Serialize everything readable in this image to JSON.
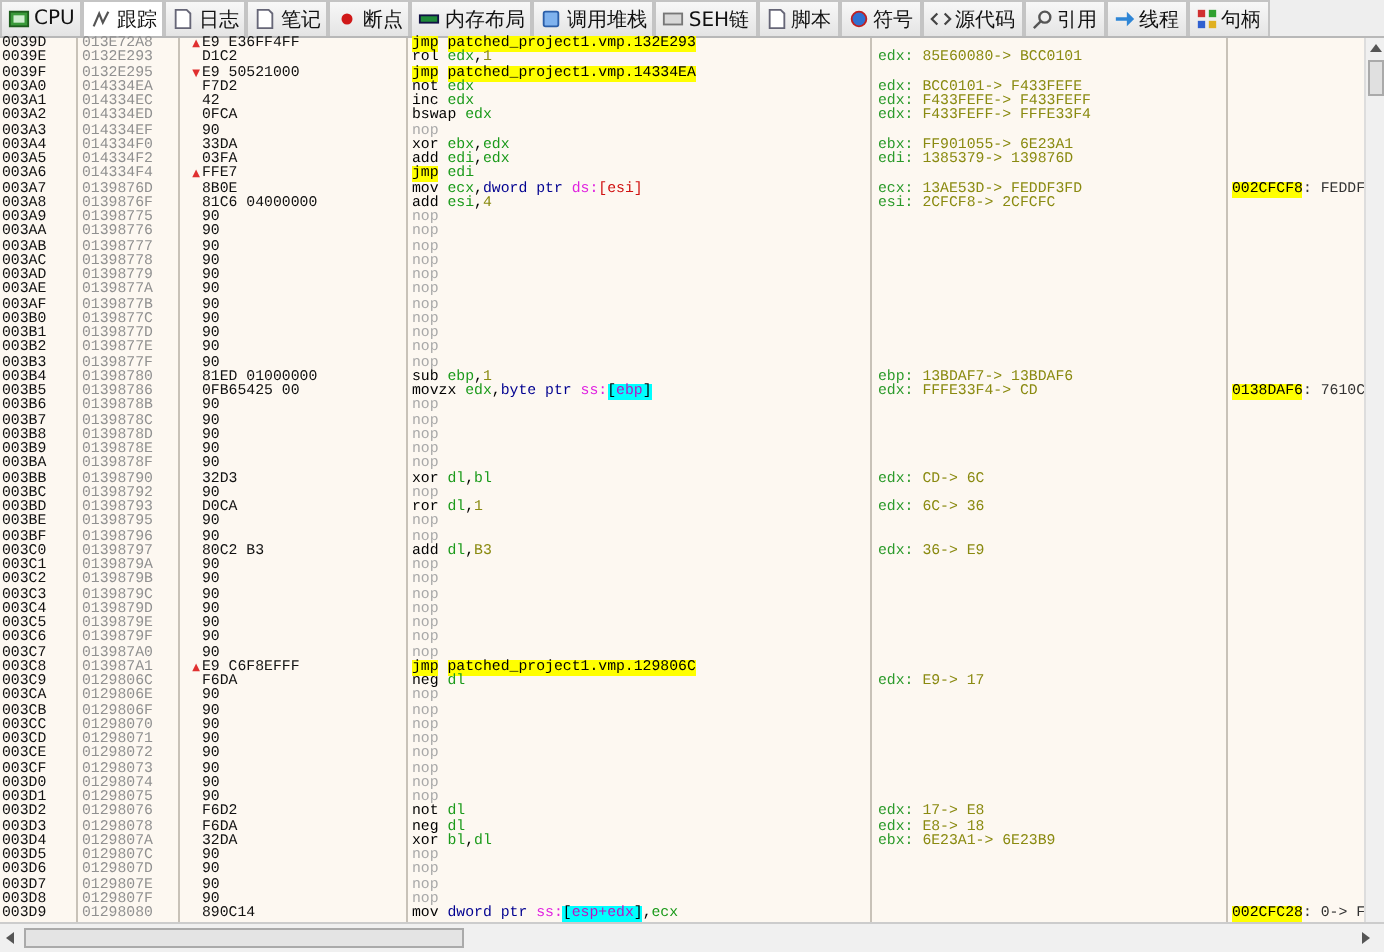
{
  "tabs": [
    {
      "label": "CPU",
      "selected": false
    },
    {
      "label": "跟踪",
      "selected": true
    },
    {
      "label": "日志",
      "selected": false
    },
    {
      "label": "笔记",
      "selected": false
    },
    {
      "label": "断点",
      "selected": false
    },
    {
      "label": "内存布局",
      "selected": false
    },
    {
      "label": "调用堆栈",
      "selected": false
    },
    {
      "label": "SEH链",
      "selected": false
    },
    {
      "label": "脚本",
      "selected": false
    },
    {
      "label": "符号",
      "selected": false
    },
    {
      "label": "源代码",
      "selected": false
    },
    {
      "label": "引用",
      "selected": false
    },
    {
      "label": "线程",
      "selected": false
    },
    {
      "label": "句柄",
      "selected": false
    }
  ],
  "trace": {
    "rows": [
      {
        "index": "0039D",
        "address": "013E72A8",
        "jump_arrow": "▲",
        "bytes": "E9 E36FF4FF",
        "instruction": [
          {
            "kind": "jmp",
            "text": "jmp"
          },
          {
            "kind": "target",
            "text": "patched_project1.vmp.132E293"
          }
        ]
      },
      {
        "index": "0039E",
        "address": "0132E293",
        "bytes": "D1C2",
        "instruction": [
          {
            "kind": "op",
            "text": "rol"
          },
          {
            "kind": "reg",
            "text": "edx"
          },
          {
            "kind": "punct",
            "text": ","
          },
          {
            "kind": "imm",
            "text": "1"
          }
        ],
        "comment": {
          "reg": "edx:",
          "change": "85E60080-> BCC0101"
        }
      },
      {
        "index": "0039F",
        "address": "0132E295",
        "jump_arrow": "▼",
        "bytes": "E9 50521000",
        "instruction": [
          {
            "kind": "jmp",
            "text": "jmp"
          },
          {
            "kind": "target",
            "text": "patched_project1.vmp.14334EA"
          }
        ]
      },
      {
        "index": "003A0",
        "address": "014334EA",
        "bytes": "F7D2",
        "instruction": [
          {
            "kind": "op",
            "text": "not"
          },
          {
            "kind": "reg",
            "text": "edx"
          }
        ],
        "comment": {
          "reg": "edx:",
          "change": "BCC0101-> F433FEFE"
        }
      },
      {
        "index": "003A1",
        "address": "014334EC",
        "bytes": "42",
        "instruction": [
          {
            "kind": "op",
            "text": "inc"
          },
          {
            "kind": "reg",
            "text": "edx"
          }
        ],
        "comment": {
          "reg": "edx:",
          "change": "F433FEFE-> F433FEFF"
        }
      },
      {
        "index": "003A2",
        "address": "014334ED",
        "bytes": "0FCA",
        "instruction": [
          {
            "kind": "op",
            "text": "bswap"
          },
          {
            "kind": "reg",
            "text": "edx"
          }
        ],
        "comment": {
          "reg": "edx:",
          "change": "F433FEFF-> FFFE33F4"
        }
      },
      {
        "index": "003A3",
        "address": "014334EF",
        "bytes": "90",
        "instruction": [
          {
            "kind": "nop",
            "text": "nop"
          }
        ]
      },
      {
        "index": "003A4",
        "address": "014334F0",
        "bytes": "33DA",
        "instruction": [
          {
            "kind": "op",
            "text": "xor"
          },
          {
            "kind": "reg",
            "text": "ebx"
          },
          {
            "kind": "punct",
            "text": ","
          },
          {
            "kind": "reg",
            "text": "edx"
          }
        ],
        "comment": {
          "reg": "ebx:",
          "change": "FF901055-> 6E23A1"
        }
      },
      {
        "index": "003A5",
        "address": "014334F2",
        "bytes": "03FA",
        "instruction": [
          {
            "kind": "op",
            "text": "add"
          },
          {
            "kind": "reg",
            "text": "edi"
          },
          {
            "kind": "punct",
            "text": ","
          },
          {
            "kind": "reg",
            "text": "edx"
          }
        ],
        "comment": {
          "reg": "edi:",
          "change": "1385379-> 139876D"
        }
      },
      {
        "index": "003A6",
        "address": "014334F4",
        "jump_arrow": "▲",
        "bytes": "FFE7",
        "instruction": [
          {
            "kind": "jmp",
            "text": "jmp"
          },
          {
            "kind": "reg",
            "text": "edi"
          }
        ]
      },
      {
        "index": "003A7",
        "address": "0139876D",
        "bytes": "8B0E",
        "instruction": [
          {
            "kind": "op",
            "text": "mov"
          },
          {
            "kind": "reg",
            "text": "ecx"
          },
          {
            "kind": "punct",
            "text": ","
          },
          {
            "kind": "size",
            "text": "dword ptr"
          },
          {
            "kind": "seg",
            "text": "ds:"
          },
          {
            "kind": "memplain",
            "text": "[esi]"
          }
        ],
        "comment": {
          "reg": "ecx:",
          "change": "13AE53D-> FEDDF3FD"
        },
        "memory": {
          "address": "002CFCF8",
          "value": ": FEDDF"
        }
      },
      {
        "index": "003A8",
        "address": "0139876F",
        "bytes": "81C6 04000000",
        "instruction": [
          {
            "kind": "op",
            "text": "add"
          },
          {
            "kind": "reg",
            "text": "esi"
          },
          {
            "kind": "punct",
            "text": ","
          },
          {
            "kind": "imm",
            "text": "4"
          }
        ],
        "comment": {
          "reg": "esi:",
          "change": "2CFCF8-> 2CFCFC"
        }
      },
      {
        "index": "003A9",
        "address": "01398775",
        "bytes": "90",
        "instruction": [
          {
            "kind": "nop",
            "text": "nop"
          }
        ]
      },
      {
        "index": "003AA",
        "address": "01398776",
        "bytes": "90",
        "instruction": [
          {
            "kind": "nop",
            "text": "nop"
          }
        ]
      },
      {
        "index": "003AB",
        "address": "01398777",
        "bytes": "90",
        "instruction": [
          {
            "kind": "nop",
            "text": "nop"
          }
        ]
      },
      {
        "index": "003AC",
        "address": "01398778",
        "bytes": "90",
        "instruction": [
          {
            "kind": "nop",
            "text": "nop"
          }
        ]
      },
      {
        "index": "003AD",
        "address": "01398779",
        "bytes": "90",
        "instruction": [
          {
            "kind": "nop",
            "text": "nop"
          }
        ]
      },
      {
        "index": "003AE",
        "address": "0139877A",
        "bytes": "90",
        "instruction": [
          {
            "kind": "nop",
            "text": "nop"
          }
        ]
      },
      {
        "index": "003AF",
        "address": "0139877B",
        "bytes": "90",
        "instruction": [
          {
            "kind": "nop",
            "text": "nop"
          }
        ]
      },
      {
        "index": "003B0",
        "address": "0139877C",
        "bytes": "90",
        "instruction": [
          {
            "kind": "nop",
            "text": "nop"
          }
        ]
      },
      {
        "index": "003B1",
        "address": "0139877D",
        "bytes": "90",
        "instruction": [
          {
            "kind": "nop",
            "text": "nop"
          }
        ]
      },
      {
        "index": "003B2",
        "address": "0139877E",
        "bytes": "90",
        "instruction": [
          {
            "kind": "nop",
            "text": "nop"
          }
        ]
      },
      {
        "index": "003B3",
        "address": "0139877F",
        "bytes": "90",
        "instruction": [
          {
            "kind": "nop",
            "text": "nop"
          }
        ]
      },
      {
        "index": "003B4",
        "address": "01398780",
        "bytes": "81ED 01000000",
        "instruction": [
          {
            "kind": "op",
            "text": "sub"
          },
          {
            "kind": "reg",
            "text": "ebp"
          },
          {
            "kind": "punct",
            "text": ","
          },
          {
            "kind": "imm",
            "text": "1"
          }
        ],
        "comment": {
          "reg": "ebp:",
          "change": "13BDAF7-> 13BDAF6"
        }
      },
      {
        "index": "003B5",
        "address": "01398786",
        "bytes": "0FB65425 00",
        "instruction": [
          {
            "kind": "op",
            "text": "movzx"
          },
          {
            "kind": "reg",
            "text": "edx"
          },
          {
            "kind": "punct",
            "text": ","
          },
          {
            "kind": "size",
            "text": "byte ptr"
          },
          {
            "kind": "seg",
            "text": "ss:"
          },
          {
            "kind": "bracket",
            "text": "["
          },
          {
            "kind": "memreg",
            "text": "ebp"
          },
          {
            "kind": "bracket",
            "text": "]"
          }
        ],
        "comment": {
          "reg": "edx:",
          "change": "FFFE33F4-> CD"
        },
        "memory": {
          "address": "0138DAF6",
          "value": ": 7610C"
        }
      },
      {
        "index": "003B6",
        "address": "0139878B",
        "bytes": "90",
        "instruction": [
          {
            "kind": "nop",
            "text": "nop"
          }
        ]
      },
      {
        "index": "003B7",
        "address": "0139878C",
        "bytes": "90",
        "instruction": [
          {
            "kind": "nop",
            "text": "nop"
          }
        ]
      },
      {
        "index": "003B8",
        "address": "0139878D",
        "bytes": "90",
        "instruction": [
          {
            "kind": "nop",
            "text": "nop"
          }
        ]
      },
      {
        "index": "003B9",
        "address": "0139878E",
        "bytes": "90",
        "instruction": [
          {
            "kind": "nop",
            "text": "nop"
          }
        ]
      },
      {
        "index": "003BA",
        "address": "0139878F",
        "bytes": "90",
        "instruction": [
          {
            "kind": "nop",
            "text": "nop"
          }
        ]
      },
      {
        "index": "003BB",
        "address": "01398790",
        "bytes": "32D3",
        "instruction": [
          {
            "kind": "op",
            "text": "xor"
          },
          {
            "kind": "reg",
            "text": "dl"
          },
          {
            "kind": "punct",
            "text": ","
          },
          {
            "kind": "reg",
            "text": "bl"
          }
        ],
        "comment": {
          "reg": "edx:",
          "change": "CD-> 6C"
        }
      },
      {
        "index": "003BC",
        "address": "01398792",
        "bytes": "90",
        "instruction": [
          {
            "kind": "nop",
            "text": "nop"
          }
        ]
      },
      {
        "index": "003BD",
        "address": "01398793",
        "bytes": "D0CA",
        "instruction": [
          {
            "kind": "op",
            "text": "ror"
          },
          {
            "kind": "reg",
            "text": "dl"
          },
          {
            "kind": "punct",
            "text": ","
          },
          {
            "kind": "imm",
            "text": "1"
          }
        ],
        "comment": {
          "reg": "edx:",
          "change": "6C-> 36"
        }
      },
      {
        "index": "003BE",
        "address": "01398795",
        "bytes": "90",
        "instruction": [
          {
            "kind": "nop",
            "text": "nop"
          }
        ]
      },
      {
        "index": "003BF",
        "address": "01398796",
        "bytes": "90",
        "instruction": [
          {
            "kind": "nop",
            "text": "nop"
          }
        ]
      },
      {
        "index": "003C0",
        "address": "01398797",
        "bytes": "80C2 B3",
        "instruction": [
          {
            "kind": "op",
            "text": "add"
          },
          {
            "kind": "reg",
            "text": "dl"
          },
          {
            "kind": "punct",
            "text": ","
          },
          {
            "kind": "imm",
            "text": "B3"
          }
        ],
        "comment": {
          "reg": "edx:",
          "change": "36-> E9"
        }
      },
      {
        "index": "003C1",
        "address": "0139879A",
        "bytes": "90",
        "instruction": [
          {
            "kind": "nop",
            "text": "nop"
          }
        ]
      },
      {
        "index": "003C2",
        "address": "0139879B",
        "bytes": "90",
        "instruction": [
          {
            "kind": "nop",
            "text": "nop"
          }
        ]
      },
      {
        "index": "003C3",
        "address": "0139879C",
        "bytes": "90",
        "instruction": [
          {
            "kind": "nop",
            "text": "nop"
          }
        ]
      },
      {
        "index": "003C4",
        "address": "0139879D",
        "bytes": "90",
        "instruction": [
          {
            "kind": "nop",
            "text": "nop"
          }
        ]
      },
      {
        "index": "003C5",
        "address": "0139879E",
        "bytes": "90",
        "instruction": [
          {
            "kind": "nop",
            "text": "nop"
          }
        ]
      },
      {
        "index": "003C6",
        "address": "0139879F",
        "bytes": "90",
        "instruction": [
          {
            "kind": "nop",
            "text": "nop"
          }
        ]
      },
      {
        "index": "003C7",
        "address": "013987A0",
        "bytes": "90",
        "instruction": [
          {
            "kind": "nop",
            "text": "nop"
          }
        ]
      },
      {
        "index": "003C8",
        "address": "013987A1",
        "jump_arrow": "▲",
        "bytes": "E9 C6F8EFFF",
        "instruction": [
          {
            "kind": "jmp",
            "text": "jmp"
          },
          {
            "kind": "target",
            "text": "patched_project1.vmp.129806C"
          }
        ]
      },
      {
        "index": "003C9",
        "address": "0129806C",
        "bytes": "F6DA",
        "instruction": [
          {
            "kind": "op",
            "text": "neg"
          },
          {
            "kind": "reg",
            "text": "dl"
          }
        ],
        "comment": {
          "reg": "edx:",
          "change": "E9-> 17"
        }
      },
      {
        "index": "003CA",
        "address": "0129806E",
        "bytes": "90",
        "instruction": [
          {
            "kind": "nop",
            "text": "nop"
          }
        ]
      },
      {
        "index": "003CB",
        "address": "0129806F",
        "bytes": "90",
        "instruction": [
          {
            "kind": "nop",
            "text": "nop"
          }
        ]
      },
      {
        "index": "003CC",
        "address": "01298070",
        "bytes": "90",
        "instruction": [
          {
            "kind": "nop",
            "text": "nop"
          }
        ]
      },
      {
        "index": "003CD",
        "address": "01298071",
        "bytes": "90",
        "instruction": [
          {
            "kind": "nop",
            "text": "nop"
          }
        ]
      },
      {
        "index": "003CE",
        "address": "01298072",
        "bytes": "90",
        "instruction": [
          {
            "kind": "nop",
            "text": "nop"
          }
        ]
      },
      {
        "index": "003CF",
        "address": "01298073",
        "bytes": "90",
        "instruction": [
          {
            "kind": "nop",
            "text": "nop"
          }
        ]
      },
      {
        "index": "003D0",
        "address": "01298074",
        "bytes": "90",
        "instruction": [
          {
            "kind": "nop",
            "text": "nop"
          }
        ]
      },
      {
        "index": "003D1",
        "address": "01298075",
        "bytes": "90",
        "instruction": [
          {
            "kind": "nop",
            "text": "nop"
          }
        ]
      },
      {
        "index": "003D2",
        "address": "01298076",
        "bytes": "F6D2",
        "instruction": [
          {
            "kind": "op",
            "text": "not"
          },
          {
            "kind": "reg",
            "text": "dl"
          }
        ],
        "comment": {
          "reg": "edx:",
          "change": "17-> E8"
        }
      },
      {
        "index": "003D3",
        "address": "01298078",
        "bytes": "F6DA",
        "instruction": [
          {
            "kind": "op",
            "text": "neg"
          },
          {
            "kind": "reg",
            "text": "dl"
          }
        ],
        "comment": {
          "reg": "edx:",
          "change": "E8-> 18"
        }
      },
      {
        "index": "003D4",
        "address": "0129807A",
        "bytes": "32DA",
        "instruction": [
          {
            "kind": "op",
            "text": "xor"
          },
          {
            "kind": "reg",
            "text": "bl"
          },
          {
            "kind": "punct",
            "text": ","
          },
          {
            "kind": "reg",
            "text": "dl"
          }
        ],
        "comment": {
          "reg": "ebx:",
          "change": "6E23A1-> 6E23B9"
        }
      },
      {
        "index": "003D5",
        "address": "0129807C",
        "bytes": "90",
        "instruction": [
          {
            "kind": "nop",
            "text": "nop"
          }
        ]
      },
      {
        "index": "003D6",
        "address": "0129807D",
        "bytes": "90",
        "instruction": [
          {
            "kind": "nop",
            "text": "nop"
          }
        ]
      },
      {
        "index": "003D7",
        "address": "0129807E",
        "bytes": "90",
        "instruction": [
          {
            "kind": "nop",
            "text": "nop"
          }
        ]
      },
      {
        "index": "003D8",
        "address": "0129807F",
        "bytes": "90",
        "instruction": [
          {
            "kind": "nop",
            "text": "nop"
          }
        ]
      },
      {
        "index": "003D9",
        "address": "01298080",
        "bytes": "890C14",
        "instruction": [
          {
            "kind": "op",
            "text": "mov"
          },
          {
            "kind": "size",
            "text": "dword ptr"
          },
          {
            "kind": "seg",
            "text": "ss:"
          },
          {
            "kind": "bracket",
            "text": "["
          },
          {
            "kind": "memreg",
            "text": "esp+edx"
          },
          {
            "kind": "bracket",
            "text": "]"
          },
          {
            "kind": "punct",
            "text": ","
          },
          {
            "kind": "reg",
            "text": "ecx"
          }
        ],
        "memory": {
          "address": "002CFC28",
          "value": ": 0-> F"
        }
      }
    ]
  }
}
